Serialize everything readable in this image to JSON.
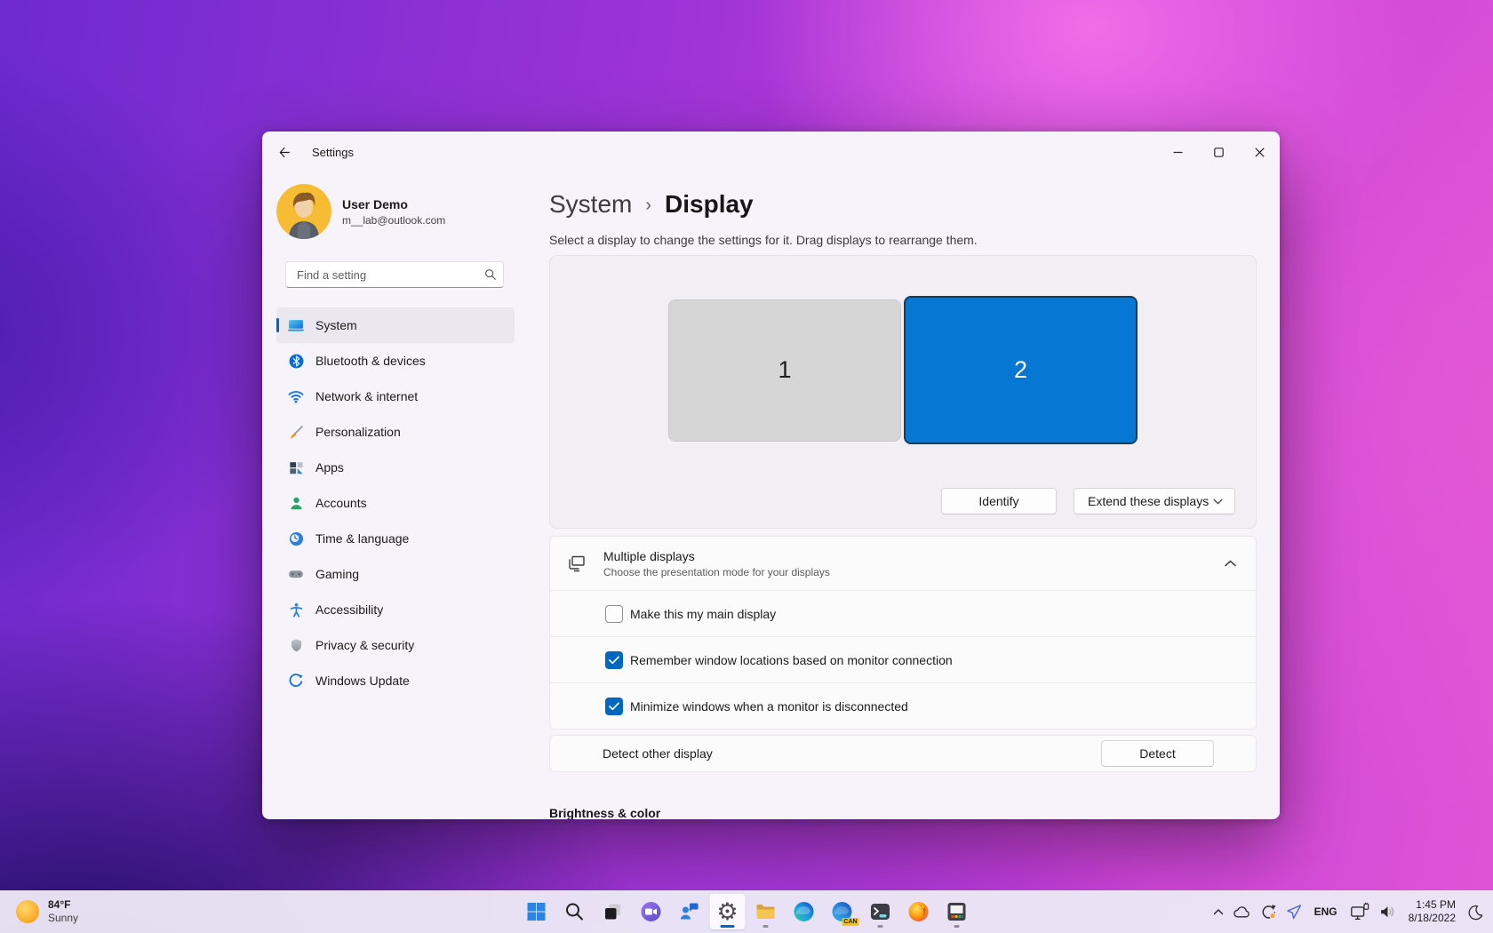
{
  "window": {
    "title": "Settings",
    "controls": {
      "minimize": "minimize",
      "maximize": "maximize",
      "close": "close"
    }
  },
  "sidebar": {
    "user": {
      "name": "User Demo",
      "email": "m__lab@outlook.com"
    },
    "search": {
      "placeholder": "Find a setting",
      "icon": "search-icon"
    },
    "items": [
      {
        "label": "System",
        "icon": "system-icon",
        "selected": true
      },
      {
        "label": "Bluetooth & devices",
        "icon": "bluetooth-icon",
        "selected": false
      },
      {
        "label": "Network & internet",
        "icon": "network-icon",
        "selected": false
      },
      {
        "label": "Personalization",
        "icon": "personalization-icon",
        "selected": false
      },
      {
        "label": "Apps",
        "icon": "apps-icon",
        "selected": false
      },
      {
        "label": "Accounts",
        "icon": "accounts-icon",
        "selected": false
      },
      {
        "label": "Time & language",
        "icon": "time-language-icon",
        "selected": false
      },
      {
        "label": "Gaming",
        "icon": "gaming-icon",
        "selected": false
      },
      {
        "label": "Accessibility",
        "icon": "accessibility-icon",
        "selected": false
      },
      {
        "label": "Privacy & security",
        "icon": "privacy-security-icon",
        "selected": false
      },
      {
        "label": "Windows Update",
        "icon": "windows-update-icon",
        "selected": false
      }
    ]
  },
  "main": {
    "breadcrumb": {
      "parent": "System",
      "separator": "›",
      "current": "Display"
    },
    "subtitle": "Select a display to change the settings for it. Drag displays to rearrange them.",
    "display_diagram": {
      "displays": [
        {
          "number": "1",
          "selected": false
        },
        {
          "number": "2",
          "selected": true
        }
      ],
      "identify_button": "Identify",
      "extend_dropdown": {
        "value": "Extend these displays",
        "icon": "chevron-down-icon"
      }
    },
    "multiple_displays": {
      "icon": "multiple-displays-icon",
      "title": "Multiple displays",
      "subtitle": "Choose the presentation mode for your displays",
      "collapse_icon": "chevron-up-icon",
      "options": [
        {
          "label": "Make this my main display",
          "checked": false
        },
        {
          "label": "Remember window locations based on monitor connection",
          "checked": true
        },
        {
          "label": "Minimize windows when a monitor is disconnected",
          "checked": true
        }
      ]
    },
    "detect": {
      "label": "Detect other display",
      "button": "Detect"
    },
    "next_section_heading": "Brightness & color"
  },
  "taskbar": {
    "weather": {
      "temperature": "84°F",
      "condition": "Sunny",
      "icon": "sun-icon"
    },
    "app_icons": [
      {
        "name": "start-icon",
        "active": false,
        "running": false
      },
      {
        "name": "search-icon",
        "active": false,
        "running": false
      },
      {
        "name": "task-view-icon",
        "active": false,
        "running": false
      },
      {
        "name": "chat-icon",
        "active": false,
        "running": false
      },
      {
        "name": "people-icon",
        "active": false,
        "running": false
      },
      {
        "name": "settings-gear-icon",
        "active": true,
        "running": true
      },
      {
        "name": "file-explorer-icon",
        "active": false,
        "running": true
      },
      {
        "name": "edge-icon",
        "active": false,
        "running": false
      },
      {
        "name": "edge-canary-icon",
        "active": false,
        "running": false,
        "badge": "CAN"
      },
      {
        "name": "terminal-icon",
        "active": false,
        "running": true
      },
      {
        "name": "firefox-icon",
        "active": false,
        "running": false
      },
      {
        "name": "color-app-icon",
        "active": false,
        "running": true
      }
    ],
    "tray": {
      "chevron_icon": "chevron-up-icon",
      "icons": [
        "onedrive-cloud-icon",
        "sync-icon",
        "location-icon",
        "monitor-connect-icon",
        "volume-icon"
      ],
      "language": "ENG",
      "time": "1:45 PM",
      "date": "8/18/2022",
      "moon_icon": "moon-icon"
    }
  },
  "colors": {
    "accent": "#0067c0",
    "display_selected": "#0677d2",
    "display_unselected": "#d6d6d6",
    "taskbar_bg": "#ece8f6"
  }
}
